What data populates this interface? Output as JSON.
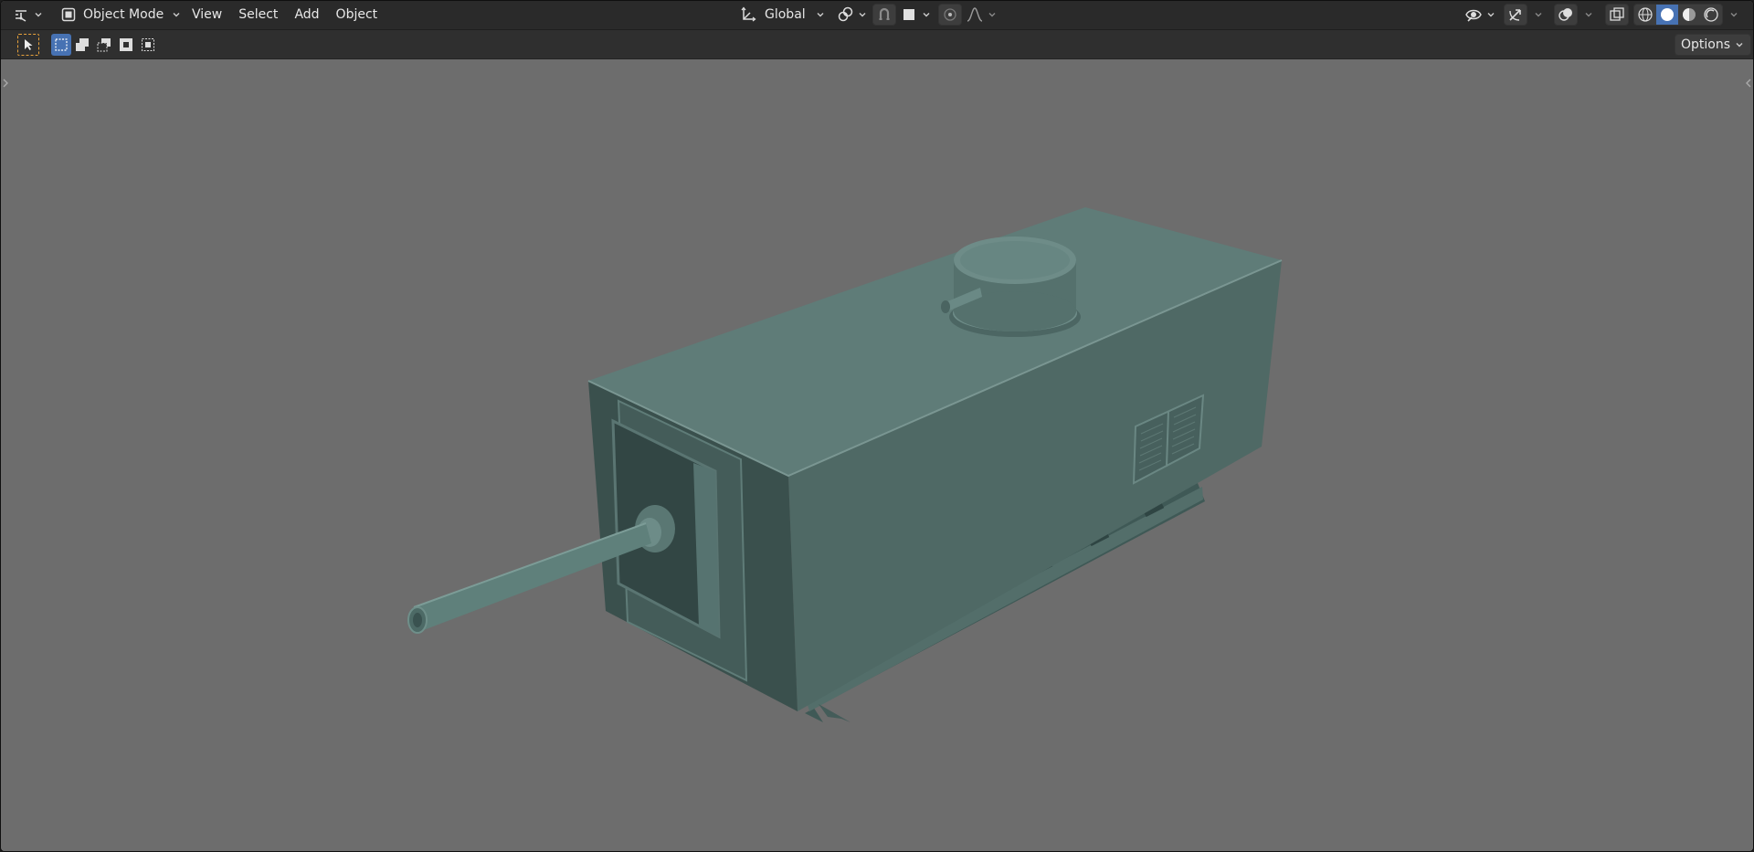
{
  "header": {
    "mode_label": "Object Mode",
    "menus": [
      "View",
      "Select",
      "Add",
      "Object"
    ],
    "orientation_label": "Global"
  },
  "tool_header": {
    "options_label": "Options"
  },
  "icons": {
    "editor_type": "editor-type-icon",
    "mode": "object-mode-icon",
    "transform_orientation": "transform-orientation-icon",
    "pivot": "pivot-point-icon",
    "snap": "snap-icon",
    "snap_target": "snap-increment-icon",
    "proportional": "proportional-edit-icon",
    "falloff": "falloff-curve-icon",
    "visibility": "eye-icon",
    "gizmo": "gizmo-icon",
    "overlay": "overlay-icon",
    "xray": "xray-icon",
    "shading": [
      "wireframe-shading-icon",
      "solid-shading-icon",
      "material-shading-icon",
      "rendered-shading-icon"
    ]
  },
  "colors": {
    "header_bg": "#2a2a2a",
    "viewport_bg": "#6d6d6d",
    "accent_blue": "#4772b3",
    "tool_active_orange": "#e8a23c",
    "model_color": "#5f7c78"
  }
}
